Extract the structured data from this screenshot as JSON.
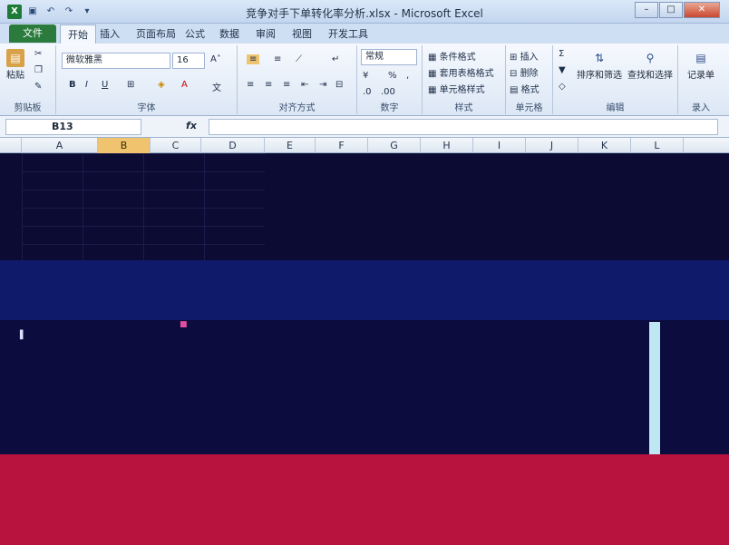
{
  "window": {
    "title": "竞争对手下单转化率分析.xlsx - Microsoft Excel",
    "app_icon": "X",
    "controls": {
      "minimize": "–",
      "maximize": "□",
      "close": "✕"
    }
  },
  "tabs": {
    "file": "文件",
    "items": [
      "开始",
      "插入",
      "页面布局",
      "公式",
      "数据",
      "审阅",
      "视图",
      "开发工具"
    ],
    "active": "开始"
  },
  "ribbon": {
    "clipboard": {
      "paste": "粘贴",
      "label": "剪贴板"
    },
    "font": {
      "name": "微软雅黑",
      "size": "16",
      "bold": "B",
      "italic": "I",
      "underline": "U",
      "label": "字体"
    },
    "alignment": {
      "label": "对齐方式"
    },
    "number": {
      "format": "常规",
      "percent": "%",
      "comma": ",",
      "label": "数字"
    },
    "styles": {
      "conditional": "条件格式",
      "table": "套用表格格式",
      "cell": "单元格样式",
      "label": "样式"
    },
    "cells": {
      "insert": "插入",
      "delete": "删除",
      "format": "格式",
      "label": "单元格"
    },
    "editing": {
      "sort": "排序和筛选",
      "find": "查找和选择",
      "label": "编辑"
    },
    "record": {
      "button": "记录单",
      "label": "录入"
    }
  },
  "formula_bar": {
    "name_box": "B13",
    "fx": "fx",
    "value": ""
  },
  "columns": [
    "A",
    "B",
    "C",
    "D",
    "E",
    "F",
    "G",
    "H",
    "I",
    "J",
    "K",
    "L"
  ],
  "selected_column": "B",
  "colors": {
    "excel_green": "#2a7b3c",
    "ribbon_bg": "#dce7f5",
    "selected_header": "#f0c46f"
  }
}
